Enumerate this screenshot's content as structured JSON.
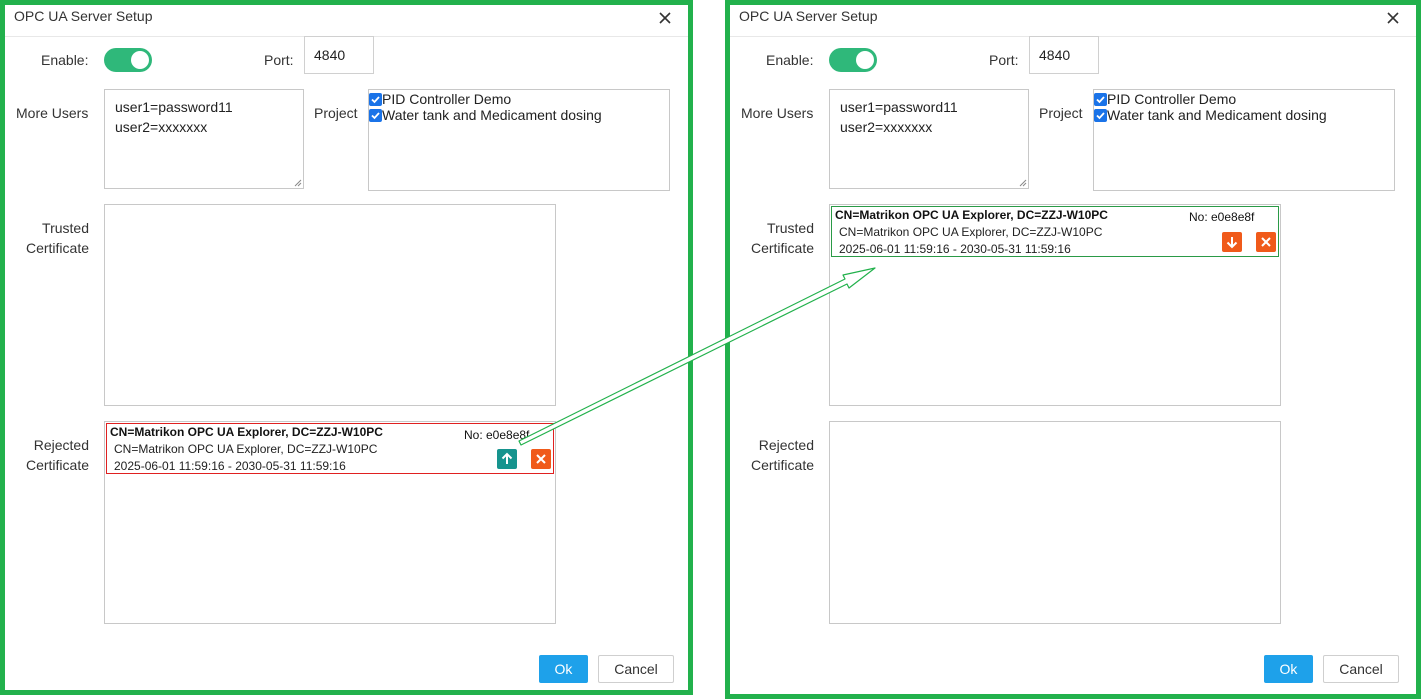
{
  "before": {
    "title": "OPC UA Server Setup",
    "enable_label": "Enable:",
    "enable_on": true,
    "port_label": "Port:",
    "port_value": "4840",
    "more_users_label": "More Users",
    "users": [
      "user1=password11",
      "user2=xxxxxxx"
    ],
    "project_label": "Project",
    "projects": [
      {
        "label": "PID Controller Demo",
        "checked": true
      },
      {
        "label": "Water tank and Medicament dosing",
        "checked": true
      }
    ],
    "trusted_label": [
      "Trusted",
      "Certificate"
    ],
    "rejected_label": [
      "Rejected",
      "Certificate"
    ],
    "trusted_certs": [],
    "rejected_certs": [
      {
        "cn": "CN=Matrikon OPC UA Explorer, DC=ZZJ-W10PC",
        "no": "No: e0e8e8f",
        "subject": "CN=Matrikon OPC UA Explorer, DC=ZZJ-W10PC",
        "validity": "2025-06-01 11:59:16 - 2030-05-31 11:59:16",
        "actions": [
          "arrow-up-icon",
          "close-icon"
        ]
      }
    ],
    "ok_label": "Ok",
    "cancel_label": "Cancel"
  },
  "after": {
    "title": "OPC UA Server Setup",
    "enable_label": "Enable:",
    "enable_on": true,
    "port_label": "Port:",
    "port_value": "4840",
    "more_users_label": "More Users",
    "users": [
      "user1=password11",
      "user2=xxxxxxx"
    ],
    "project_label": "Project",
    "projects": [
      {
        "label": "PID Controller Demo",
        "checked": true
      },
      {
        "label": "Water tank and Medicament dosing",
        "checked": true
      }
    ],
    "trusted_label": [
      "Trusted",
      "Certificate"
    ],
    "rejected_label": [
      "Rejected",
      "Certificate"
    ],
    "trusted_certs": [
      {
        "cn": "CN=Matrikon OPC UA Explorer, DC=ZZJ-W10PC",
        "no": "No: e0e8e8f",
        "subject": "CN=Matrikon OPC UA Explorer, DC=ZZJ-W10PC",
        "validity": "2025-06-01 11:59:16 - 2030-05-31 11:59:16",
        "actions": [
          "arrow-down-icon",
          "close-icon"
        ]
      }
    ],
    "rejected_certs": [],
    "ok_label": "Ok",
    "cancel_label": "Cancel"
  },
  "colors": {
    "frame_highlight": "#22b14c",
    "toggle_on": "#2fb87a",
    "ok_button": "#1ea1ea",
    "trust_button": "#16948e",
    "delete_button": "#f05a1a",
    "rejected_border": "#e02020",
    "trusted_border": "#2a9a46",
    "checkbox": "#1a73e8"
  }
}
